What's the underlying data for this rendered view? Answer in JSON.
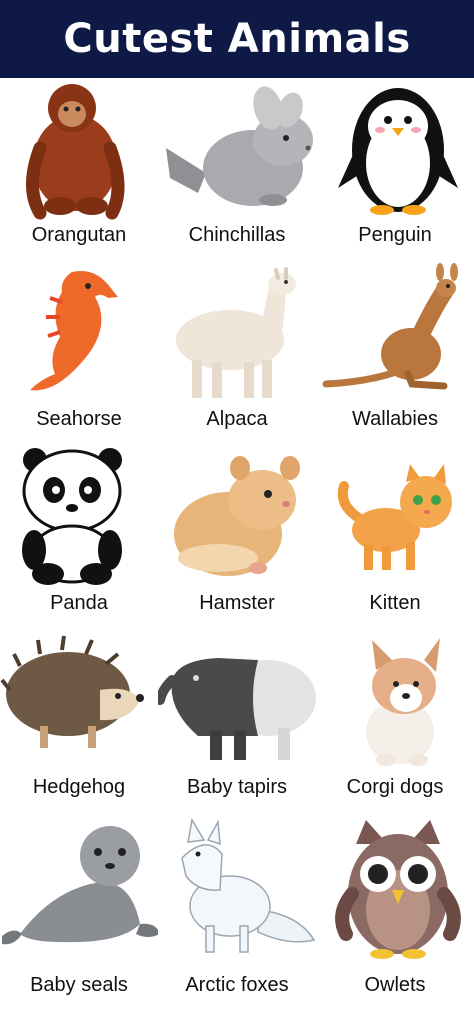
{
  "header": {
    "title": "Cutest Animals",
    "background": "#0e1a45"
  },
  "animals": [
    {
      "label": "Orangutan",
      "icon": "orangutan-icon"
    },
    {
      "label": "Chinchillas",
      "icon": "chinchilla-icon"
    },
    {
      "label": "Penguin",
      "icon": "penguin-icon"
    },
    {
      "label": "Seahorse",
      "icon": "seahorse-icon"
    },
    {
      "label": "Alpaca",
      "icon": "alpaca-icon"
    },
    {
      "label": "Wallabies",
      "icon": "wallaby-icon"
    },
    {
      "label": "Panda",
      "icon": "panda-icon"
    },
    {
      "label": "Hamster",
      "icon": "hamster-icon"
    },
    {
      "label": "Kitten",
      "icon": "kitten-icon"
    },
    {
      "label": "Hedgehog",
      "icon": "hedgehog-icon"
    },
    {
      "label": "Baby tapirs",
      "icon": "tapir-icon"
    },
    {
      "label": "Corgi dogs",
      "icon": "corgi-icon"
    },
    {
      "label": "Baby seals",
      "icon": "seal-icon"
    },
    {
      "label": "Arctic foxes",
      "icon": "arctic-fox-icon"
    },
    {
      "label": "Owlets",
      "icon": "owlet-icon"
    }
  ]
}
